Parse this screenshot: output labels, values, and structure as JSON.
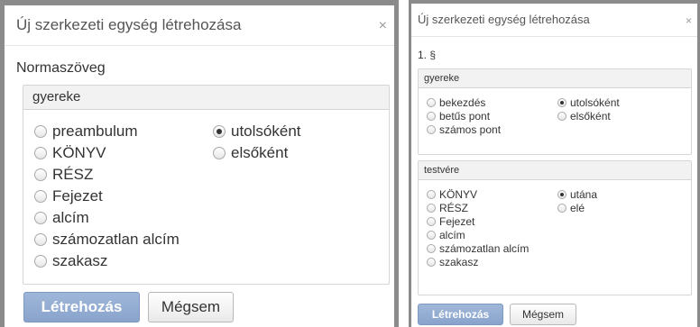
{
  "colors": {
    "frame": "#8b8b8b",
    "primary_button": "#89a3cc",
    "legend_bg": "#f2f2f2",
    "text": "#333333"
  },
  "dialog1": {
    "title": "Új szerkezeti egység létrehozása",
    "close_icon": "close-icon",
    "close_glyph": "×",
    "subtitle": "Normaszöveg",
    "fieldset_legend": "gyereke",
    "type_options": [
      {
        "label": "preambulum",
        "checked": false
      },
      {
        "label": "KÖNYV",
        "checked": false
      },
      {
        "label": "RÉSZ",
        "checked": false
      },
      {
        "label": "Fejezet",
        "checked": false
      },
      {
        "label": "alcím",
        "checked": false
      },
      {
        "label": "számozatlan alcím",
        "checked": false
      },
      {
        "label": "szakasz",
        "checked": false
      }
    ],
    "position_options": [
      {
        "label": "utolsóként",
        "checked": true
      },
      {
        "label": "elsőként",
        "checked": false
      }
    ],
    "create_label": "Létrehozás",
    "cancel_label": "Mégsem"
  },
  "dialog2": {
    "title": "Új szerkezeti egység létrehozása",
    "close_icon": "close-icon",
    "close_glyph": "×",
    "subtitle": "1. §",
    "child_legend": "gyereke",
    "child_type_options": [
      {
        "label": "bekezdés",
        "checked": false
      },
      {
        "label": "betűs pont",
        "checked": false
      },
      {
        "label": "számos pont",
        "checked": false
      }
    ],
    "child_position_options": [
      {
        "label": "utolsóként",
        "checked": true
      },
      {
        "label": "elsőként",
        "checked": false
      }
    ],
    "sibling_legend": "testvére",
    "sibling_type_options": [
      {
        "label": "KÖNYV",
        "checked": false
      },
      {
        "label": "RÉSZ",
        "checked": false
      },
      {
        "label": "Fejezet",
        "checked": false
      },
      {
        "label": "alcím",
        "checked": false
      },
      {
        "label": "számozatlan alcím",
        "checked": false
      },
      {
        "label": "szakasz",
        "checked": false
      }
    ],
    "sibling_position_options": [
      {
        "label": "utána",
        "checked": true
      },
      {
        "label": "elé",
        "checked": false
      }
    ],
    "create_label": "Létrehozás",
    "cancel_label": "Mégsem"
  }
}
